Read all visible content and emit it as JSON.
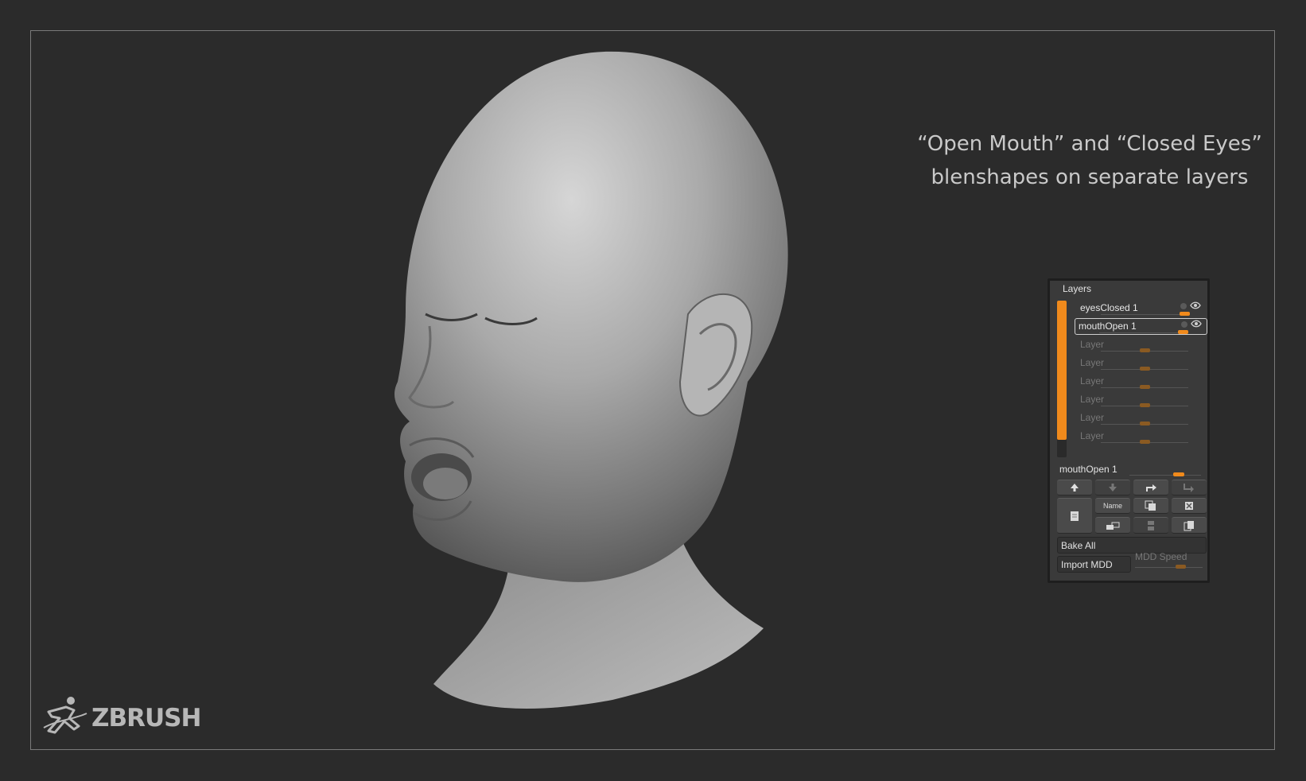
{
  "caption": {
    "line1": "“Open Mouth” and “Closed Eyes”",
    "line2": "blenshapes on separate layers"
  },
  "logo": {
    "text": "ZBRUSH",
    "icon": "zbrush-runner-icon"
  },
  "layers_panel": {
    "title": "Layers",
    "layers": [
      {
        "name": "eyesClosed 1",
        "strength": 0.95,
        "state": "active"
      },
      {
        "name": "mouthOpen 1",
        "strength": 0.95,
        "state": "selected"
      },
      {
        "name": "Layer",
        "strength": 0.5,
        "state": "empty"
      },
      {
        "name": "Layer",
        "strength": 0.5,
        "state": "empty"
      },
      {
        "name": "Layer",
        "strength": 0.5,
        "state": "empty"
      },
      {
        "name": "Layer",
        "strength": 0.5,
        "state": "empty"
      },
      {
        "name": "Layer",
        "strength": 0.5,
        "state": "empty"
      },
      {
        "name": "Layer",
        "strength": 0.5,
        "state": "empty"
      }
    ],
    "active_layer_name": "mouthOpen 1",
    "name_button": "Name",
    "bake_all": "Bake All",
    "import_mdd": "Import MDD",
    "mdd_speed": "MDD Speed",
    "accent_color": "#f08a1c"
  }
}
